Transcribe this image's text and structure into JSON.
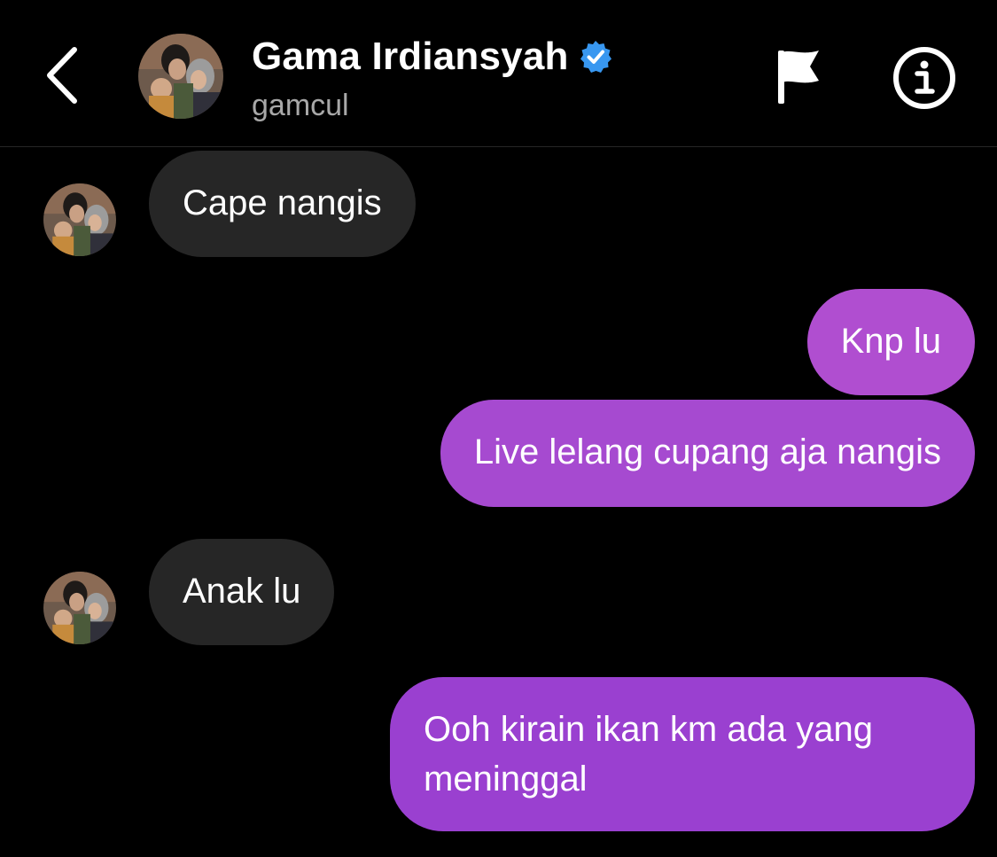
{
  "header": {
    "title": "Gama Irdiansyah",
    "subtitle": "gamcul",
    "verified": true
  },
  "icons": {
    "back": "chevron-left-icon",
    "verified": "verified-badge-icon",
    "flag": "flag-icon",
    "info": "info-icon"
  },
  "colors": {
    "background": "#000000",
    "incoming_bubble": "#262626",
    "outgoing_bubble_top": "#b04ed0",
    "outgoing_bubble_bottom": "#9a40d0",
    "verified_badge": "#3897f0",
    "subtitle": "#a8a8a8"
  },
  "messages": [
    {
      "direction": "incoming",
      "text": "Cape nangis"
    },
    {
      "direction": "outgoing",
      "text": "Knp lu"
    },
    {
      "direction": "outgoing",
      "text": "Live lelang cupang aja nangis"
    },
    {
      "direction": "incoming",
      "text": "Anak lu"
    },
    {
      "direction": "outgoing",
      "text": "Ooh kirain ikan km ada yang meninggal"
    }
  ]
}
